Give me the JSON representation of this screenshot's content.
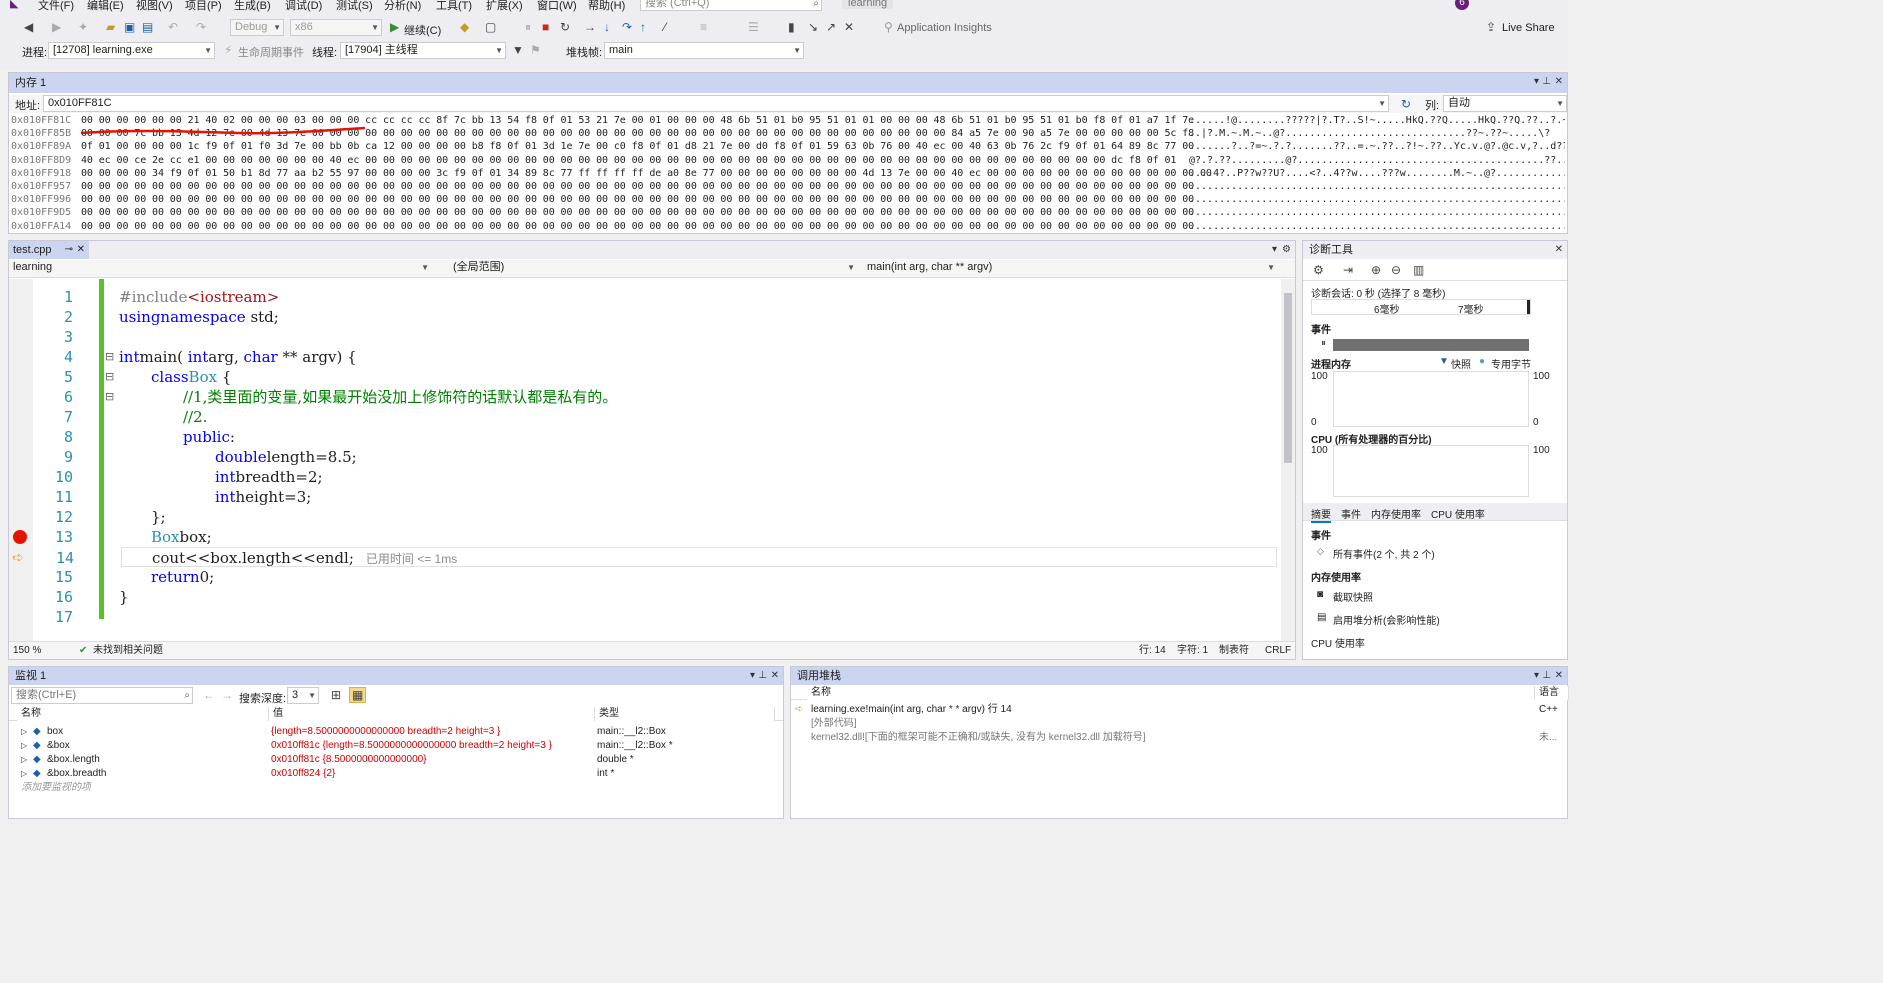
{
  "menu": {
    "items": [
      "文件(F)",
      "编辑(E)",
      "视图(V)",
      "项目(P)",
      "生成(B)",
      "调试(D)",
      "测试(S)",
      "分析(N)",
      "工具(T)",
      "扩展(X)",
      "窗口(W)",
      "帮助(H)"
    ],
    "search_placeholder": "搜索 (Ctrl+Q)",
    "solution_name": "learning",
    "notifications_count": "6"
  },
  "toolbar1": {
    "config": "Debug",
    "platform": "x86",
    "continue_label": "继续(C)",
    "app_insights": "Application Insights",
    "live_share": "Live Share"
  },
  "toolbar2": {
    "process_label": "进程:",
    "process_value": "[12708] learning.exe",
    "lifecycle_label": "生命周期事件",
    "thread_label": "线程:",
    "thread_value": "[17904] 主线程",
    "stackframe_label": "堆栈帧:",
    "stackframe_value": "main"
  },
  "memory": {
    "title": "内存 1",
    "address_label": "地址:",
    "address_value": "0x010FF81C",
    "columns_label": "列:",
    "columns_value": "自动",
    "rows": [
      {
        "addr": "0x010FF81C",
        "hex": "00 00 00 00 00 00 21 40 02 00 00 00 03 00 00 00 cc cc cc cc 8f 7c bb 13 54 f8 0f 01 53 21 7e 00 01 00 00 00 48 6b 51 01 b0 95 51 01 01 00 00 00 48 6b 51 01 b0 95 51 01 b0 f8 0f 01 a7 1f 7e",
        "ascii": "......!@........?????|?.T?..S!~.....HkQ.??Q.....HkQ.??Q.??..?.~"
      },
      {
        "addr": "0x010FF85B",
        "hex": "00 00 00 7c bb 13 4d 12 7e 00 4d 13 7e 00 00 00 00 00 00 00 00 00 00 00 00 00 00 00 00 00 00 00 00 00 00 00 00 00 00 00 00 00 00 00 00 00 00 00 00 84 a5 7e 00 90 a5 7e 00 00 00 00 00 5c f8",
        "ascii": "..|?.M.~.M.~..@?..............................??~.??~.....\\?"
      },
      {
        "addr": "0x010FF89A",
        "hex": "0f 01 00 00 00 00 1c f9 0f 01 f0 3d 7e 00 bb 0b ca 12 00 00 00 00 b8 f8 0f 01 3d 1e 7e 00 c0 f8 0f 01 d8 21 7e 00 d0 f8 0f 01 59 63 0b 76 00 40 ec 00 40 63 0b 76 2c f9 0f 01 64 89 8c 77 00",
        "ascii": ".......?..?=~.?.?.......??..=.~.??..?!~.??..Yc.v.@?.@c.v,?..d??w."
      },
      {
        "addr": "0x010FF8D9",
        "hex": "40 ec 00 ce 2e cc e1 00 00 00 00 00 00 00 40 ec 00 00 00 00 00 00 00 00 00 00 00 00 00 00 00 00 00 00 00 00 00 00 00 00 00 00 00 00 00 00 00 00 00 00 00 00 00 00 00 00 00 00 dc f8 0f 01",
        "ascii": "@?.?.??.........@?.........................................??.."
      },
      {
        "addr": "0x010FF918",
        "hex": "00 00 00 00 34 f9 0f 01 50 b1 8d 77 aa b2 55 97 00 00 00 00 3c f9 0f 01 34 89 8c 77 ff ff ff ff de a0 8e 77 00 00 00 00 00 00 00 00 4d 13 7e 00 00 40 ec 00 00 00 00 00 00 00 00 00 00 00 00 00",
        "ascii": "....4?..P??w??U?....<?..4??w....???w........M.~..@?............"
      },
      {
        "addr": "0x010FF957",
        "hex": "00 00 00 00 00 00 00 00 00 00 00 00 00 00 00 00 00 00 00 00 00 00 00 00 00 00 00 00 00 00 00 00 00 00 00 00 00 00 00 00 00 00 00 00 00 00 00 00 00 00 00 00 00 00 00 00 00 00 00 00 00 00 00",
        "ascii": "..............................................................."
      },
      {
        "addr": "0x010FF996",
        "hex": "00 00 00 00 00 00 00 00 00 00 00 00 00 00 00 00 00 00 00 00 00 00 00 00 00 00 00 00 00 00 00 00 00 00 00 00 00 00 00 00 00 00 00 00 00 00 00 00 00 00 00 00 00 00 00 00 00 00 00 00 00 00 00",
        "ascii": "..............................................................."
      },
      {
        "addr": "0x010FF9D5",
        "hex": "00 00 00 00 00 00 00 00 00 00 00 00 00 00 00 00 00 00 00 00 00 00 00 00 00 00 00 00 00 00 00 00 00 00 00 00 00 00 00 00 00 00 00 00 00 00 00 00 00 00 00 00 00 00 00 00 00 00 00 00 00 00 00",
        "ascii": "..............................................................."
      },
      {
        "addr": "0x010FFA14",
        "hex": "00 00 00 00 00 00 00 00 00 00 00 00 00 00 00 00 00 00 00 00 00 00 00 00 00 00 00 00 00 00 00 00 00 00 00 00 00 00 00 00 00 00 00 00 00 00 00 00 00 00 00 00 00 00 00 00 00 00 00 00 00 00 00",
        "ascii": "..............................................................."
      }
    ]
  },
  "editor": {
    "tab": "test.cpp",
    "nav_project": "learning",
    "nav_scope": "(全局范围)",
    "nav_function": "main(int arg, char ** argv)",
    "elapsed": "已用时间 <= 1ms",
    "zoom": "150 %",
    "issues": "未找到相关问题",
    "status_line": "行: 14",
    "status_char": "字符: 1",
    "status_tab": "制表符",
    "status_eol": "CRLF",
    "lines": [
      {
        "n": "1"
      },
      {
        "n": "2"
      },
      {
        "n": "3"
      },
      {
        "n": "4"
      },
      {
        "n": "5"
      },
      {
        "n": "6"
      },
      {
        "n": "7"
      },
      {
        "n": "8"
      },
      {
        "n": "9"
      },
      {
        "n": "10"
      },
      {
        "n": "11"
      },
      {
        "n": "12"
      },
      {
        "n": "13"
      },
      {
        "n": "14"
      },
      {
        "n": "15"
      },
      {
        "n": "16"
      },
      {
        "n": "17"
      }
    ],
    "code": {
      "l1_pp": "#include",
      "l1_inc": "<iostream>",
      "l2_kw1": "using",
      "l2_kw2": "namespace",
      "l2_rest": "std;",
      "l4_kw": "int",
      "l4_a": "main(",
      "l4_kw2": "int",
      "l4_b": "arg,",
      "l4_kw3": "char",
      "l4_c": "** argv) {",
      "l5_kw": "class",
      "l5_ty": "Box",
      "l5_rest": "{",
      "l6_cm": "//1,类里面的变量,如果最开始没加上修饰符的话默认都是私有的。",
      "l7_cm": "//2.",
      "l8_kw": "public",
      "l8_rest": ":",
      "l9_kw": "double",
      "l9_rest": "length=8.5;",
      "l10_kw": "int",
      "l10_rest": "breadth=2;",
      "l11_kw": "int",
      "l11_rest": "height=3;",
      "l12": "};",
      "l13_ty": "Box",
      "l13_rest": "box;",
      "l14": "cout<<box.length<<endl;",
      "l15_kw": "return",
      "l15_rest": "0;",
      "l16": "}"
    }
  },
  "diagnostics": {
    "title": "诊断工具",
    "session": "诊断会话: 0 秒 (选择了 8 毫秒)",
    "tick1": "6毫秒",
    "tick2": "7毫秒",
    "events_label": "事件",
    "process_memory": "进程内存",
    "snapshot_legend": "快照",
    "private_bytes_legend": "专用字节",
    "mem_max": "100",
    "mem_min": "0",
    "cpu_label": "CPU (所有处理器的百分比)",
    "cpu_max": "100",
    "cpu_min": "0",
    "tabs": [
      "摘要",
      "事件",
      "内存使用率",
      "CPU 使用率"
    ],
    "events_heading": "事件",
    "all_events": "所有事件(2 个, 共 2 个)",
    "memory_heading": "内存使用率",
    "take_snapshot": "截取快照",
    "heap_profiling": "启用堆分析(会影响性能)",
    "cpu_heading": "CPU 使用率"
  },
  "watch": {
    "title": "监视 1",
    "search_placeholder": "搜索(Ctrl+E)",
    "depth_label": "搜索深度:",
    "depth_value": "3",
    "col_name": "名称",
    "col_value": "值",
    "col_type": "类型",
    "rows": [
      {
        "name": "box",
        "value": "{length=8.5000000000000000 breadth=2 height=3 }",
        "type": "main::__l2::Box"
      },
      {
        "name": "&box",
        "value": "0x010ff81c {length=8.5000000000000000 breadth=2 height=3 }",
        "type": "main::__l2::Box *"
      },
      {
        "name": "&box.length",
        "value": "0x010ff81c {8.5000000000000000}",
        "type": "double *"
      },
      {
        "name": "&box.breadth",
        "value": "0x010ff824 {2}",
        "type": "int *"
      }
    ],
    "add_item": "添加要监视的项"
  },
  "callstack": {
    "title": "调用堆栈",
    "col_name": "名称",
    "col_lang": "语言",
    "rows": [
      {
        "name": "learning.exe!main(int arg, char * * argv) 行 14",
        "lang": "C++"
      },
      {
        "name": "[外部代码]",
        "lang": ""
      },
      {
        "name": "kernel32.dll![下面的框架可能不正确和/或缺失, 没有为 kernel32.dll 加载符号]",
        "lang": "未..."
      }
    ]
  },
  "colors": {
    "accent": "#ccd5f0",
    "breakpoint": "#e51400",
    "change_bar": "#57c22c",
    "annotation": "#e51400"
  }
}
